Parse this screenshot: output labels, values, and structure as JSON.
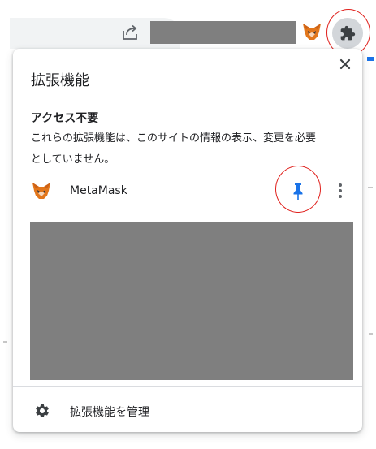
{
  "toolbar": {
    "share_icon": "share-icon",
    "extension_icon": "puzzle-piece-icon"
  },
  "popup": {
    "title": "拡張機能",
    "close_icon": "close-icon",
    "section_heading": "アクセス不要",
    "section_description_lines": [
      "これらの拡張機能は、このサイトの情報の表示、変更を必要",
      "としていません。"
    ],
    "extensions": [
      {
        "name": "MetaMask",
        "icon": "metamask-fox-icon",
        "pinned": true,
        "pin_icon": "pin-icon",
        "menu_icon": "more-vert-icon"
      }
    ],
    "manage_label": "拡張機能を管理",
    "manage_icon": "gear-icon"
  },
  "colors": {
    "pin_active": "#1a73e8",
    "annotation_circle": "#e0201c",
    "redaction": "#7f7f7f",
    "extension_button_bg": "#d3d6da",
    "omnibox_bg": "#f1f3f4"
  }
}
